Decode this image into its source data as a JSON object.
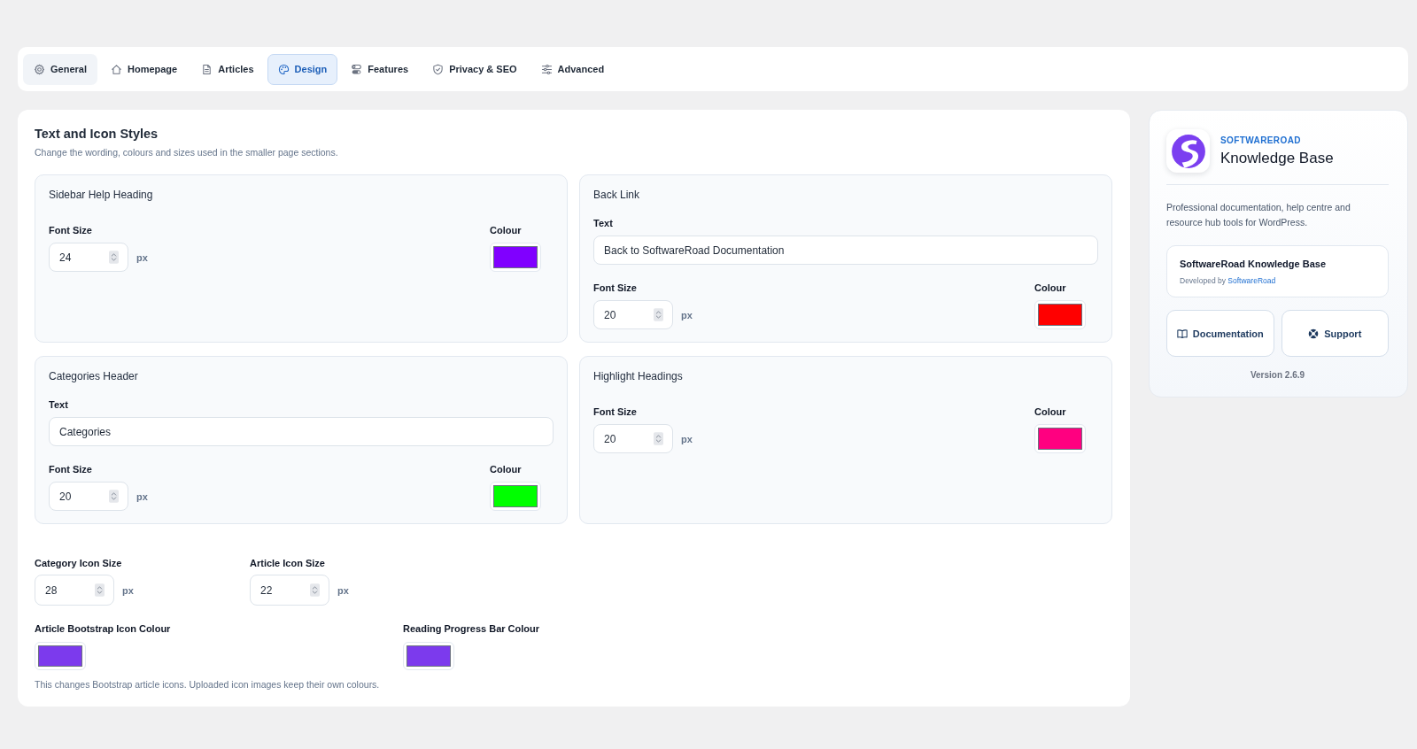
{
  "tabs": [
    {
      "label": "General",
      "selected": false,
      "hovered": true
    },
    {
      "label": "Homepage",
      "selected": false,
      "hovered": false
    },
    {
      "label": "Articles",
      "selected": false,
      "hovered": false
    },
    {
      "label": "Design",
      "selected": true,
      "hovered": false
    },
    {
      "label": "Features",
      "selected": false,
      "hovered": false
    },
    {
      "label": "Privacy & SEO",
      "selected": false,
      "hovered": false
    },
    {
      "label": "Advanced",
      "selected": false,
      "hovered": false
    }
  ],
  "section": {
    "title": "Text and Icon Styles",
    "description": "Change the wording, colours and sizes used in the smaller page sections.",
    "groups": [
      {
        "title": "Sidebar Help Heading",
        "font_size": {
          "label": "Font Size",
          "value": "24",
          "unit": "px"
        },
        "colour": {
          "label": "Colour",
          "color": "#8000ff"
        }
      },
      {
        "title": "Back Link",
        "text": {
          "label": "Text",
          "value": "Back to SoftwareRoad Documentation"
        },
        "font_size": {
          "label": "Font Size",
          "value": "20",
          "unit": "px"
        },
        "colour": {
          "label": "Colour",
          "color": "#ff0000"
        }
      },
      {
        "title": "Categories Header",
        "text": {
          "label": "Text",
          "value": "Categories"
        },
        "font_size": {
          "label": "Font Size",
          "value": "20",
          "unit": "px"
        },
        "colour": {
          "label": "Colour",
          "color": "#00ff00"
        }
      },
      {
        "title": "Highlight Headings",
        "font_size": {
          "label": "Font Size",
          "value": "20",
          "unit": "px"
        },
        "colour": {
          "label": "Colour",
          "color": "#ff0080"
        }
      }
    ],
    "icon_sizes": [
      {
        "label": "Category Icon Size",
        "value": "28",
        "unit": "px"
      },
      {
        "label": "Article Icon Size",
        "value": "22",
        "unit": "px"
      }
    ],
    "icon_colours": [
      {
        "label": "Article Bootstrap Icon Colour",
        "color": "#7c3aed"
      },
      {
        "label": "Reading Progress Bar Colour",
        "color": "#7c3aed"
      }
    ],
    "note": "This changes Bootstrap article icons. Uploaded icon images keep their own colours."
  },
  "sidebar": {
    "brand": "SOFTWAREROAD",
    "product": "Knowledge Base",
    "description": "Professional documentation, help centre and resource hub tools for WordPress.",
    "plugin_card": {
      "name": "SoftwareRoad Knowledge Base",
      "developer_prefix": "Developed by",
      "developer_link": "SoftwareRoad"
    },
    "buttons": [
      {
        "label": "Documentation"
      },
      {
        "label": "Support"
      }
    ],
    "version": "Version 2.6.9"
  }
}
